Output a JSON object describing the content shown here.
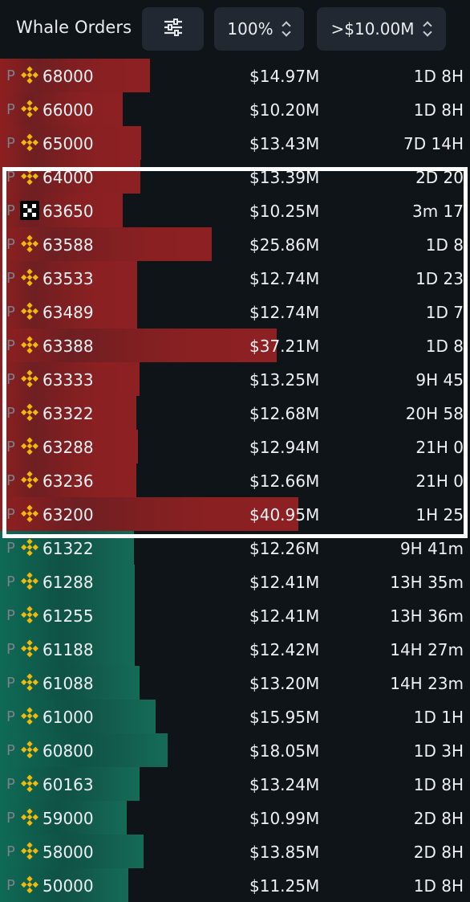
{
  "header": {
    "title": "Whale Orders",
    "filter_icon": "sliders-icon",
    "zoom": "100%",
    "threshold": ">$10.00M"
  },
  "colors": {
    "ask": "#8d2022",
    "bid": "#156b57",
    "highlight": "#ffffff",
    "binance": "#f0b90b"
  },
  "rows": [
    {
      "side": "ask",
      "prefix": "P",
      "exchange": "binance",
      "price": "68000",
      "amount": "$14.97M",
      "time": "1D 8H",
      "size": 14.97
    },
    {
      "side": "ask",
      "prefix": "P",
      "exchange": "binance",
      "price": "66000",
      "amount": "$10.20M",
      "time": "1D 8H",
      "size": 10.2
    },
    {
      "side": "ask",
      "prefix": "P",
      "exchange": "binance",
      "price": "65000",
      "amount": "$13.43M",
      "time": "7D 14H",
      "size": 13.43
    },
    {
      "side": "ask",
      "prefix": "P",
      "exchange": "binance",
      "price": "64000",
      "amount": "$13.39M",
      "time": "2D 20",
      "size": 13.39
    },
    {
      "side": "ask",
      "prefix": "P",
      "exchange": "okx",
      "price": "63650",
      "amount": "$10.25M",
      "time": "3m 17",
      "size": 10.25
    },
    {
      "side": "ask",
      "prefix": "P",
      "exchange": "binance",
      "price": "63588",
      "amount": "$25.86M",
      "time": "1D 8",
      "size": 25.86
    },
    {
      "side": "ask",
      "prefix": "P",
      "exchange": "binance",
      "price": "63533",
      "amount": "$12.74M",
      "time": "1D 23",
      "size": 12.74
    },
    {
      "side": "ask",
      "prefix": "P",
      "exchange": "binance",
      "price": "63489",
      "amount": "$12.74M",
      "time": "1D 7",
      "size": 12.74
    },
    {
      "side": "ask",
      "prefix": "P",
      "exchange": "binance",
      "price": "63388",
      "amount": "$37.21M",
      "time": "1D 8",
      "size": 37.21
    },
    {
      "side": "ask",
      "prefix": "P",
      "exchange": "binance",
      "price": "63333",
      "amount": "$13.25M",
      "time": "9H 45",
      "size": 13.25
    },
    {
      "side": "ask",
      "prefix": "P",
      "exchange": "binance",
      "price": "63322",
      "amount": "$12.68M",
      "time": "20H 58",
      "size": 12.68
    },
    {
      "side": "ask",
      "prefix": "P",
      "exchange": "binance",
      "price": "63288",
      "amount": "$12.94M",
      "time": "21H 0",
      "size": 12.94
    },
    {
      "side": "ask",
      "prefix": "P",
      "exchange": "binance",
      "price": "63236",
      "amount": "$12.66M",
      "time": "21H 0",
      "size": 12.66
    },
    {
      "side": "ask",
      "prefix": "P",
      "exchange": "binance",
      "price": "63200",
      "amount": "$40.95M",
      "time": "1H 25",
      "size": 40.95
    },
    {
      "side": "bid",
      "prefix": "P",
      "exchange": "binance",
      "price": "61322",
      "amount": "$12.26M",
      "time": "9H 41m",
      "size": 12.26
    },
    {
      "side": "bid",
      "prefix": "P",
      "exchange": "binance",
      "price": "61288",
      "amount": "$12.41M",
      "time": "13H 35m",
      "size": 12.41
    },
    {
      "side": "bid",
      "prefix": "P",
      "exchange": "binance",
      "price": "61255",
      "amount": "$12.41M",
      "time": "13H 36m",
      "size": 12.41
    },
    {
      "side": "bid",
      "prefix": "P",
      "exchange": "binance",
      "price": "61188",
      "amount": "$12.42M",
      "time": "14H 27m",
      "size": 12.42
    },
    {
      "side": "bid",
      "prefix": "P",
      "exchange": "binance",
      "price": "61088",
      "amount": "$13.20M",
      "time": "14H 23m",
      "size": 13.2
    },
    {
      "side": "bid",
      "prefix": "P",
      "exchange": "binance",
      "price": "61000",
      "amount": "$15.95M",
      "time": "1D 1H",
      "size": 15.95
    },
    {
      "side": "bid",
      "prefix": "P",
      "exchange": "binance",
      "price": "60800",
      "amount": "$18.05M",
      "time": "1D 3H",
      "size": 18.05
    },
    {
      "side": "bid",
      "prefix": "P",
      "exchange": "binance",
      "price": "60163",
      "amount": "$13.24M",
      "time": "1D 8H",
      "size": 13.24
    },
    {
      "side": "bid",
      "prefix": "P",
      "exchange": "binance",
      "price": "59000",
      "amount": "$10.99M",
      "time": "2D 8H",
      "size": 10.99
    },
    {
      "side": "bid",
      "prefix": "P",
      "exchange": "binance",
      "price": "58000",
      "amount": "$13.85M",
      "time": "2D 8H",
      "size": 13.85
    },
    {
      "side": "bid",
      "prefix": "P",
      "exchange": "binance",
      "price": "50000",
      "amount": "$11.25M",
      "time": "1D 8H",
      "size": 11.25
    }
  ]
}
